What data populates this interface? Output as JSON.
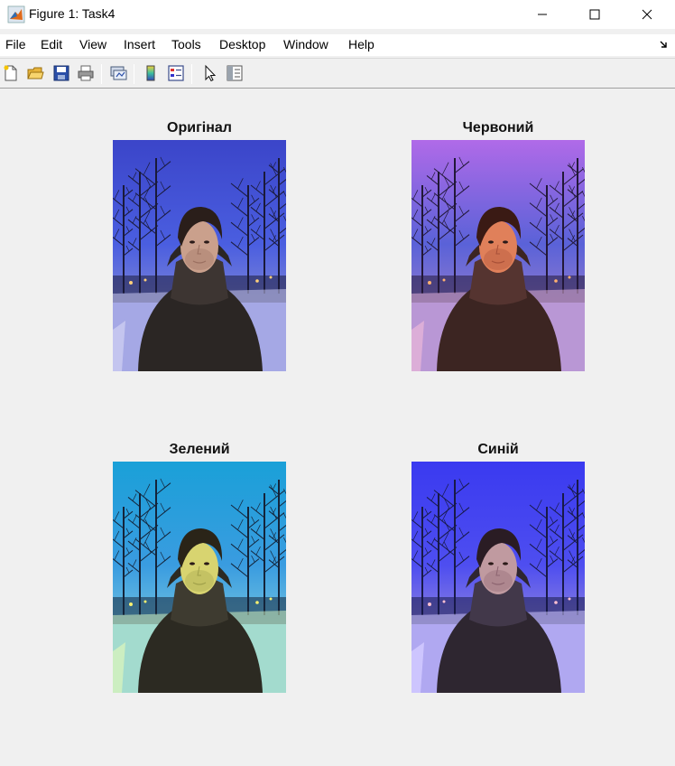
{
  "window": {
    "title": "Figure 1: Task4",
    "icon": "matlab-icon"
  },
  "menu": {
    "items": [
      {
        "label": "File"
      },
      {
        "label": "Edit"
      },
      {
        "label": "View"
      },
      {
        "label": "Insert"
      },
      {
        "label": "Tools"
      },
      {
        "label": "Desktop"
      },
      {
        "label": "Window"
      },
      {
        "label": "Help"
      }
    ]
  },
  "toolbar": {
    "buttons": [
      "new-figure-icon",
      "open-file-icon",
      "save-icon",
      "print-icon",
      "link-plot-icon",
      "colorbar-icon",
      "legend-icon",
      "edit-plot-icon",
      "property-inspector-icon"
    ]
  },
  "subplots": [
    {
      "title": "Оригінал",
      "tint": "original"
    },
    {
      "title": "Червоний",
      "tint": "red"
    },
    {
      "title": "Зелений",
      "tint": "green"
    },
    {
      "title": "Синій",
      "tint": "blue"
    }
  ]
}
